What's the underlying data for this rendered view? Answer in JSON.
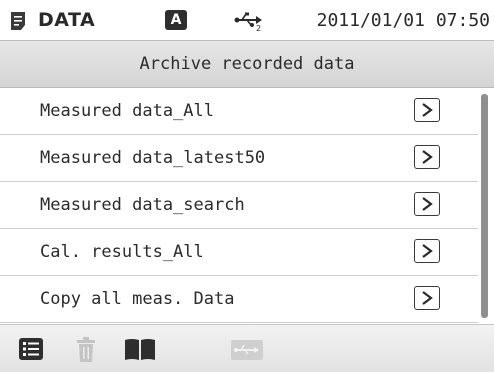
{
  "status_bar": {
    "title": "DATA",
    "mode_badge": "A",
    "datetime": "2011/01/01 07:50"
  },
  "header": {
    "title": "Archive recorded data"
  },
  "menu": {
    "items": [
      {
        "label": "Measured data_All"
      },
      {
        "label": "Measured data_latest50"
      },
      {
        "label": "Measured data_search"
      },
      {
        "label": "Cal. results_All"
      },
      {
        "label": "Copy all meas. Data"
      }
    ],
    "scroll_fraction_visible": 1.0
  },
  "toolbar": {
    "buttons": [
      {
        "icon": "list-icon",
        "enabled": true
      },
      {
        "icon": "trash-icon",
        "enabled": false
      },
      {
        "icon": "book-icon",
        "enabled": true
      },
      {
        "icon": "usb-icon",
        "enabled": false
      }
    ]
  },
  "colors": {
    "header_bg": "#dcdcdc",
    "text": "#2b2b2b",
    "disabled_icon": "#c4c4c4"
  }
}
